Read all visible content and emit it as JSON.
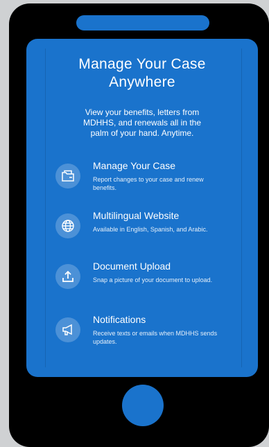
{
  "screen": {
    "title_line1": "Manage Your Case",
    "title_line2": "Anywhere",
    "subtitle": "View your benefits, letters from MDHHS, and renewals all in the palm of your hand. Anytime."
  },
  "features": [
    {
      "title": "Manage Your Case",
      "description": "Report changes to your case and renew benefits.",
      "icon": "folder-icon"
    },
    {
      "title": "Multilingual Website",
      "description": "Available in English, Spanish, and Arabic.",
      "icon": "globe-icon"
    },
    {
      "title": "Document Upload",
      "description": "Snap a picture of your document to upload.",
      "icon": "upload-icon"
    },
    {
      "title": "Notifications",
      "description": "Receive texts or emails when MDHHS sends updates.",
      "icon": "megaphone-icon"
    }
  ],
  "colors": {
    "phone_body": "#000000",
    "accent_blue": "#1a73cc",
    "background": "#cfd1d3"
  }
}
